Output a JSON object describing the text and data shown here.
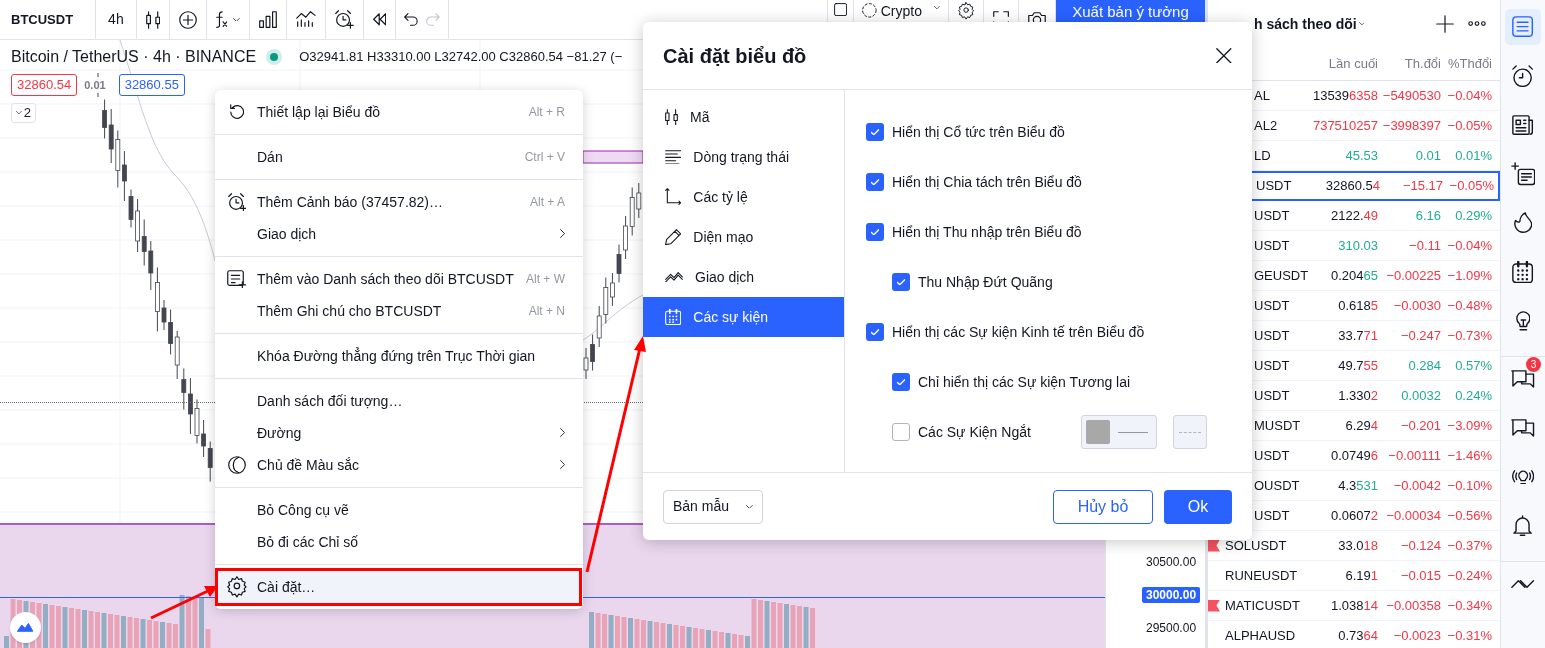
{
  "toolbar": {
    "symbol": "BTCUSDT",
    "interval": "4h",
    "history_buttons": [
      {
        "disabled": false
      },
      {
        "disabled": true
      }
    ],
    "market_dropdown": "Crypto",
    "publish_button": "Xuất bản ý tưởng"
  },
  "chart": {
    "legend_title": "Bitcoin / TetherUS · 4h · BINANCE",
    "ohlc": "O32941.81 H33310.00 L32742.00 C32860.54 −81.27 (−",
    "sell_price": "32860.54",
    "spread": "0.01",
    "buy_price": "32860.55",
    "collapse_button": "2",
    "price_axis": [
      {
        "label": "30500.00",
        "selected": false
      },
      {
        "label": "30000.00",
        "selected": true
      },
      {
        "label": "29500.00",
        "selected": false
      }
    ]
  },
  "context_menu": {
    "sections": [
      {
        "items": [
          {
            "label": "Thiết lập lại Biểu đồ",
            "shortcut": "Alt + R",
            "submenu": false,
            "highlighted": false
          }
        ]
      },
      {
        "items": [
          {
            "label": "Dán",
            "shortcut": "Ctrl + V",
            "submenu": false,
            "highlighted": false
          }
        ]
      },
      {
        "items": [
          {
            "label": "Thêm Cảnh báo (37457.82)…",
            "shortcut": "Alt + A",
            "submenu": false,
            "highlighted": false
          },
          {
            "label": "Giao dịch",
            "submenu": true,
            "highlighted": false
          }
        ]
      },
      {
        "items": [
          {
            "label": "Thêm vào Danh sách theo dõi BTCUSDT",
            "shortcut": "Alt + W",
            "submenu": false,
            "highlighted": false
          },
          {
            "label": "Thêm Ghi chú cho BTCUSDT",
            "shortcut": "Alt + N",
            "submenu": false,
            "highlighted": false
          }
        ]
      },
      {
        "items": [
          {
            "label": "Khóa Đường thẳng đứng trên Trục Thời gian",
            "submenu": false,
            "highlighted": false
          }
        ]
      },
      {
        "items": [
          {
            "label": "Danh sách đối tượng…",
            "submenu": false,
            "highlighted": false
          },
          {
            "label": "Đường",
            "submenu": true,
            "highlighted": false
          },
          {
            "label": "Chủ đề Màu sắc",
            "submenu": true,
            "highlighted": false
          }
        ]
      },
      {
        "items": [
          {
            "label": "Bỏ Công cụ vẽ",
            "submenu": false,
            "highlighted": false
          },
          {
            "label": "Bỏ đi các Chỉ số",
            "submenu": false,
            "highlighted": false
          }
        ]
      },
      {
        "items": [
          {
            "label": "Cài đặt…",
            "submenu": false,
            "highlighted": true
          }
        ]
      }
    ]
  },
  "dialog": {
    "title": "Cài đặt biểu đồ",
    "tabs": [
      {
        "label": "Mã",
        "selected": false
      },
      {
        "label": "Dòng trạng thái",
        "selected": false
      },
      {
        "label": "Các tỷ lệ",
        "selected": false
      },
      {
        "label": "Diện mạo",
        "selected": false
      },
      {
        "label": "Giao dịch",
        "selected": false
      },
      {
        "label": "Các sự kiện",
        "selected": true
      }
    ],
    "options": [
      {
        "kind": "checkbox",
        "label": "Hiển thị Cổ tức trên Biểu đồ",
        "checked": true
      },
      {
        "kind": "checkbox",
        "label": "Hiển thị Chia tách trên Biểu đồ",
        "checked": true
      },
      {
        "kind": "checkbox",
        "label": "Hiển thị Thu nhập trên Biểu đồ",
        "checked": true,
        "children": [
          {
            "kind": "checkbox",
            "label": "Thu Nhập Đứt Quãng",
            "checked": true
          }
        ]
      },
      {
        "kind": "checkbox",
        "label": "Hiển thị các Sự kiện Kinh tế trên Biểu đồ",
        "checked": true,
        "children": [
          {
            "kind": "checkbox",
            "label": "Chỉ hiển thị các Sự kiện Tương lai",
            "checked": true
          },
          {
            "kind": "checkbox_style",
            "label": "Các Sự Kiện Ngắt",
            "checked": false
          }
        ]
      }
    ],
    "template_dropdown": "Bản mẫu",
    "cancel_button": "Hủy bỏ",
    "ok_button": "Ok"
  },
  "watchlist": {
    "title": "h sách theo dõi",
    "columns": [
      "Lần cuối",
      "Th.đổi",
      "%Thđổi"
    ],
    "rows": [
      {
        "symbol": "AL",
        "flag": false,
        "last": "13539",
        "last_tick": "6358",
        "tick_up": false,
        "change": "−5490530",
        "percent": "−0.04%",
        "trend_up": false,
        "selected": false
      },
      {
        "symbol": "AL2",
        "flag": false,
        "last_tick": "737510257",
        "tick_up": false,
        "change": "−3998397",
        "percent": "−0.05%",
        "trend_up": false,
        "selected": false
      },
      {
        "symbol": "LD",
        "flag": false,
        "last_tick": "45.53",
        "tick_up": true,
        "change": "0.01",
        "percent": "0.01%",
        "trend_up": true,
        "selected": false
      },
      {
        "symbol": "USDT",
        "flag": false,
        "last": "32860.5",
        "last_tick": "4",
        "tick_up": false,
        "change": "−15.17",
        "percent": "−0.05%",
        "trend_up": false,
        "selected": true
      },
      {
        "symbol": "USDT",
        "flag": false,
        "last": "2122.",
        "last_tick": "49",
        "tick_up": false,
        "change": "6.16",
        "percent": "0.29%",
        "trend_up": true,
        "selected": false
      },
      {
        "symbol": "USDT",
        "flag": false,
        "last_tick": "310.03",
        "tick_up": true,
        "change": "−0.11",
        "percent": "−0.04%",
        "trend_up": false,
        "selected": false
      },
      {
        "symbol": "GEUSDT",
        "flag": false,
        "last": "0.204",
        "last_tick": "65",
        "tick_up": true,
        "change": "−0.00225",
        "percent": "−1.09%",
        "trend_up": false,
        "selected": false
      },
      {
        "symbol": "USDT",
        "flag": false,
        "last": "0.618",
        "last_tick": "5",
        "tick_up": false,
        "change": "−0.0030",
        "percent": "−0.48%",
        "trend_up": false,
        "selected": false
      },
      {
        "symbol": "USDT",
        "flag": false,
        "last": "33.7",
        "last_tick": "71",
        "tick_up": false,
        "change": "−0.247",
        "percent": "−0.73%",
        "trend_up": false,
        "selected": false
      },
      {
        "symbol": "USDT",
        "flag": false,
        "last": "49.7",
        "last_tick": "55",
        "tick_up": false,
        "change": "0.284",
        "percent": "0.57%",
        "trend_up": true,
        "selected": false
      },
      {
        "symbol": "USDT",
        "flag": false,
        "last": "1.330",
        "last_tick": "2",
        "tick_up": false,
        "change": "0.0032",
        "percent": "0.24%",
        "trend_up": true,
        "selected": false
      },
      {
        "symbol": "MUSDT",
        "flag": false,
        "last": "6.29",
        "last_tick": "4",
        "tick_up": false,
        "change": "−0.201",
        "percent": "−3.09%",
        "trend_up": false,
        "selected": false
      },
      {
        "symbol": "USDT",
        "flag": false,
        "last": "0.0749",
        "last_tick": "6",
        "tick_up": false,
        "change": "−0.00111",
        "percent": "−1.46%",
        "trend_up": false,
        "selected": false
      },
      {
        "symbol": "OUSDT",
        "flag": false,
        "last": "4.3",
        "last_tick": "531",
        "tick_up": true,
        "change": "−0.0042",
        "percent": "−0.10%",
        "trend_up": false,
        "selected": false
      },
      {
        "symbol": "USDT",
        "flag": false,
        "last": "0.0607",
        "last_tick": "2",
        "tick_up": false,
        "change": "−0.00034",
        "percent": "−0.56%",
        "trend_up": false,
        "selected": false
      },
      {
        "symbol": "SOLUSDT",
        "flag": true,
        "last": "33.0",
        "last_tick": "18",
        "tick_up": false,
        "change": "−0.124",
        "percent": "−0.37%",
        "trend_up": false,
        "selected": false
      },
      {
        "symbol": "RUNEUSDT",
        "flag": false,
        "last": "6.19",
        "last_tick": "1",
        "tick_up": false,
        "change": "−0.015",
        "percent": "−0.24%",
        "trend_up": false,
        "selected": false
      },
      {
        "symbol": "MATICUSDT",
        "flag": true,
        "last": "1.038",
        "last_tick": "14",
        "tick_up": false,
        "change": "−0.00358",
        "percent": "−0.34%",
        "trend_up": false,
        "selected": false
      },
      {
        "symbol": "ALPHAUSD",
        "flag": false,
        "last": "0.73",
        "last_tick": "64",
        "tick_up": false,
        "change": "−0.0023",
        "percent": "−0.31%",
        "trend_up": false,
        "selected": false
      }
    ]
  },
  "side_rail": {
    "items": [
      {
        "selected": true
      },
      {
        "selected": false
      },
      {
        "selected": false
      },
      {
        "selected": false
      },
      {
        "selected": false
      },
      {
        "selected": false
      },
      {
        "selected": false
      },
      {
        "selected": false,
        "badge": "3"
      },
      {
        "selected": false
      },
      {
        "selected": false
      },
      {
        "selected": false
      },
      {
        "selected": false
      }
    ]
  }
}
